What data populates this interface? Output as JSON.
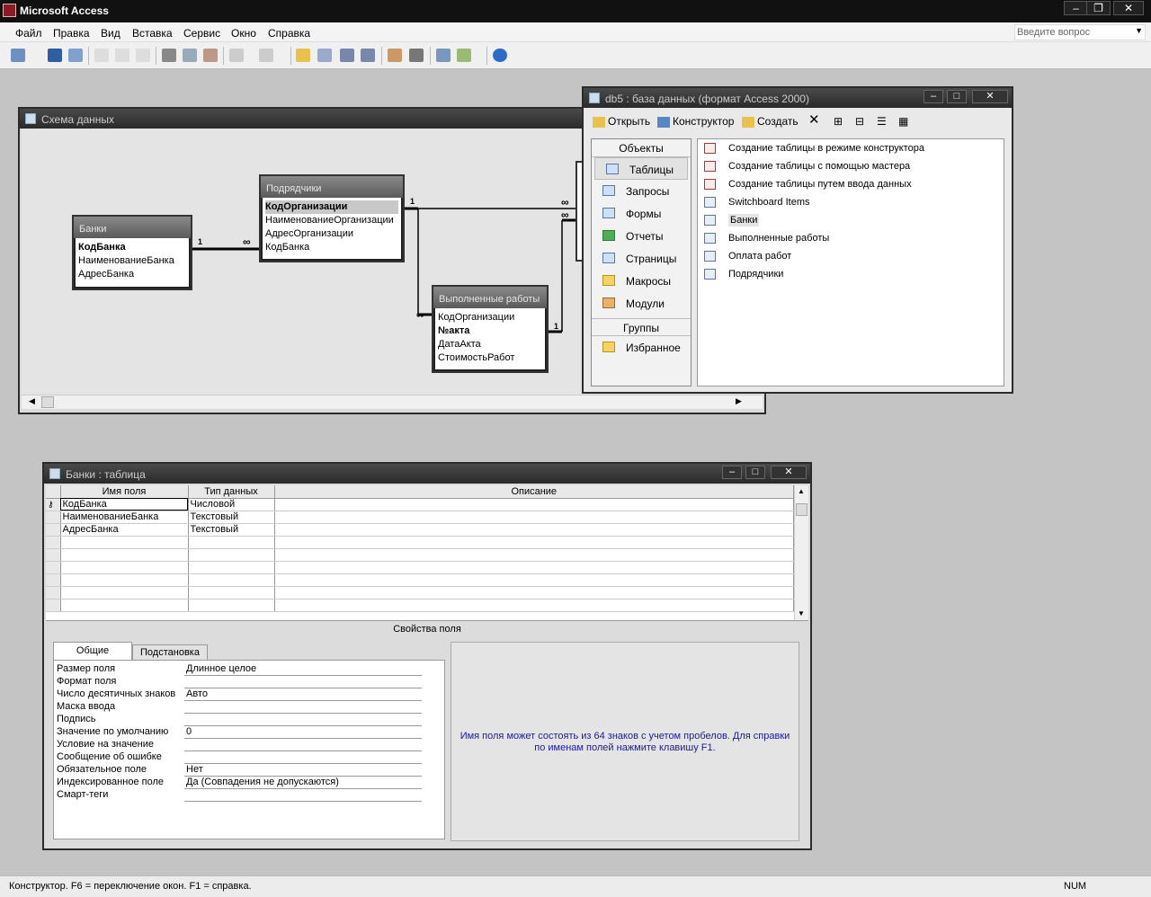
{
  "app": {
    "title": "Microsoft Access"
  },
  "menu": [
    "Файл",
    "Правка",
    "Вид",
    "Вставка",
    "Сервис",
    "Окно",
    "Справка"
  ],
  "ask_box": {
    "placeholder": "Введите вопрос"
  },
  "schema": {
    "title": "Схема данных",
    "tables": [
      {
        "name": "Банки",
        "fields": [
          "КодБанка",
          "НаименованиеБанка",
          "АдресБанка"
        ],
        "key": [
          0
        ]
      },
      {
        "name": "Подрядчики",
        "fields": [
          "КодОрганизации",
          "НаименованиеОрганизации",
          "АдресОрганизации",
          "КодБанка"
        ],
        "key": [
          0
        ]
      },
      {
        "name": "Выполненные работы",
        "fields": [
          "КодОрганизации",
          "№акта",
          "ДатаАкта",
          "СтоимостьРабот"
        ],
        "key": [
          1
        ]
      }
    ],
    "rel_labels": {
      "one": "1",
      "many": "∞"
    }
  },
  "dbwin": {
    "title": "db5 : база данных (формат Access 2000)",
    "toolbar": [
      "Открыть",
      "Конструктор",
      "Создать"
    ],
    "objects_header": "Объекты",
    "objects": [
      "Таблицы",
      "Запросы",
      "Формы",
      "Отчеты",
      "Страницы",
      "Макросы",
      "Модули"
    ],
    "groups_header": "Группы",
    "groups": [
      "Избранное"
    ],
    "items": [
      "Создание таблицы в режиме конструктора",
      "Создание таблицы с помощью мастера",
      "Создание таблицы путем ввода данных",
      "Switchboard Items",
      "Банки",
      "Выполненные работы",
      "Оплата работ",
      "Подрядчики"
    ]
  },
  "tablewin": {
    "title": "Банки : таблица",
    "columns": [
      "Имя поля",
      "Тип данных",
      "Описание"
    ],
    "rows": [
      [
        "КодБанка",
        "Числовой",
        ""
      ],
      [
        "НаименованиеБанка",
        "Текстовый",
        ""
      ],
      [
        "АдресБанка",
        "Текстовый",
        ""
      ]
    ],
    "props_title": "Свойства поля",
    "tabs": [
      "Общие",
      "Подстановка"
    ],
    "props": [
      [
        "Размер поля",
        "Длинное целое"
      ],
      [
        "Формат поля",
        ""
      ],
      [
        "Число десятичных знаков",
        "Авто"
      ],
      [
        "Маска ввода",
        ""
      ],
      [
        "Подпись",
        ""
      ],
      [
        "Значение по умолчанию",
        "0"
      ],
      [
        "Условие на значение",
        ""
      ],
      [
        "Сообщение об ошибке",
        ""
      ],
      [
        "Обязательное поле",
        "Нет"
      ],
      [
        "Индексированное поле",
        "Да (Совпадения не допускаются)"
      ],
      [
        "Смарт-теги",
        ""
      ]
    ],
    "hint": "Имя поля может состоять из 64 знаков с учетом пробелов.  Для справки по именам полей нажмите клавишу F1."
  },
  "status": {
    "left": "Конструктор.  F6 = переключение окон.  F1 = справка.",
    "right": "NUM"
  }
}
